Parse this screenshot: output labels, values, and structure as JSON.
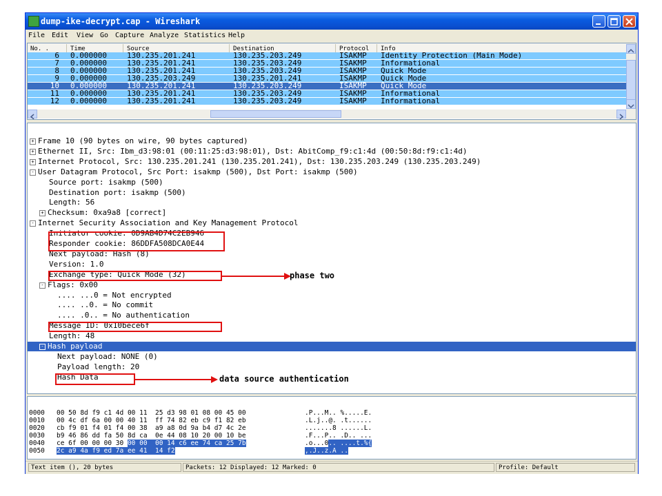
{
  "window": {
    "title": "dump-ike-decrypt.cap - Wireshark",
    "colors": {
      "titlebar": "#0a5ce0",
      "row_bg": "#7ecaff",
      "selection": "#3163c4",
      "highlight": "#e01010"
    }
  },
  "menu": [
    "File",
    "Edit",
    "View",
    "Go",
    "Capture",
    "Analyze",
    "Statistics",
    "Help"
  ],
  "packet_list": {
    "columns": [
      "No. .",
      "Time",
      "Source",
      "Destination",
      "Protocol",
      "Info"
    ],
    "rows": [
      {
        "no": "6",
        "time": "0.000000",
        "src": "130.235.201.241",
        "dst": "130.235.203.249",
        "proto": "ISAKMP",
        "info": "Identity Protection (Main Mode)"
      },
      {
        "no": "7",
        "time": "0.000000",
        "src": "130.235.201.241",
        "dst": "130.235.203.249",
        "proto": "ISAKMP",
        "info": "Informational"
      },
      {
        "no": "8",
        "time": "0.000000",
        "src": "130.235.201.241",
        "dst": "130.235.203.249",
        "proto": "ISAKMP",
        "info": "Quick Mode"
      },
      {
        "no": "9",
        "time": "0.000000",
        "src": "130.235.203.249",
        "dst": "130.235.201.241",
        "proto": "ISAKMP",
        "info": "Quick Mode"
      },
      {
        "no": "10",
        "time": "0.000000",
        "src": "130.235.201.241",
        "dst": "130.235.203.249",
        "proto": "ISAKMP",
        "info": "Quick Mode"
      },
      {
        "no": "11",
        "time": "0.000000",
        "src": "130.235.201.241",
        "dst": "130.235.203.249",
        "proto": "ISAKMP",
        "info": "Informational"
      },
      {
        "no": "12",
        "time": "0.000000",
        "src": "130.235.201.241",
        "dst": "130.235.203.249",
        "proto": "ISAKMP",
        "info": "Informational"
      }
    ],
    "selected_no": "10"
  },
  "detail_tree": [
    {
      "text": "Frame 10 (90 bytes on wire, 90 bytes captured)",
      "level": 0,
      "toggle": "+"
    },
    {
      "text": "Ethernet II, Src: Ibm_d3:98:01 (00:11:25:d3:98:01), Dst: AbitComp_f9:c1:4d (00:50:8d:f9:c1:4d)",
      "level": 0,
      "toggle": "+"
    },
    {
      "text": "Internet Protocol, Src: 130.235.201.241 (130.235.201.241), Dst: 130.235.203.249 (130.235.203.249)",
      "level": 0,
      "toggle": "+"
    },
    {
      "text": "User Datagram Protocol, Src Port: isakmp (500), Dst Port: isakmp (500)",
      "level": 0,
      "toggle": "-"
    },
    {
      "text": "Source port: isakmp (500)",
      "level": 1,
      "toggle": ""
    },
    {
      "text": "Destination port: isakmp (500)",
      "level": 1,
      "toggle": ""
    },
    {
      "text": "Length: 56",
      "level": 1,
      "toggle": ""
    },
    {
      "text": "Checksum: 0xa9a8 [correct]",
      "level": 1,
      "toggle": "+"
    },
    {
      "text": "Internet Security Association and Key Management Protocol",
      "level": 0,
      "toggle": "-"
    },
    {
      "text": "Initiator cookie: 0D9AB4D74C2EB946",
      "level": 1,
      "toggle": ""
    },
    {
      "text": "Responder cookie: 86DDFA508DCA0E44",
      "level": 1,
      "toggle": ""
    },
    {
      "text": "Next payload: Hash (8)",
      "level": 1,
      "toggle": ""
    },
    {
      "text": "Version: 1.0",
      "level": 1,
      "toggle": ""
    },
    {
      "text": "Exchange type: Quick Mode (32)",
      "level": 1,
      "toggle": ""
    },
    {
      "text": "Flags: 0x00",
      "level": 1,
      "toggle": "-"
    },
    {
      "text": ".... ...0 = Not encrypted",
      "level": 2,
      "toggle": ""
    },
    {
      "text": ".... ..0. = No commit",
      "level": 2,
      "toggle": ""
    },
    {
      "text": ".... .0.. = No authentication",
      "level": 2,
      "toggle": ""
    },
    {
      "text": "Message ID: 0x10bece6f",
      "level": 1,
      "toggle": ""
    },
    {
      "text": "Length: 48",
      "level": 1,
      "toggle": ""
    },
    {
      "text": "Hash payload",
      "level": 1,
      "toggle": "-",
      "selected": true
    },
    {
      "text": "Next payload: NONE (0)",
      "level": 2,
      "toggle": ""
    },
    {
      "text": "Payload length: 20",
      "level": 2,
      "toggle": ""
    },
    {
      "text": "Hash Data",
      "level": 2,
      "toggle": ""
    }
  ],
  "annotations": {
    "phase_two": "phase two",
    "data_source_auth": "data source authentication"
  },
  "hex_dump": [
    {
      "offset": "0000",
      "bytes": "00 50 8d f9 c1 4d 00 11  25 d3 98 01 08 00 45 00",
      "ascii": ".P...M.. %.....E."
    },
    {
      "offset": "0010",
      "bytes": "00 4c df 6a 00 00 40 11  ff 74 82 eb c9 f1 82 eb",
      "ascii": ".L.j..@. .t......"
    },
    {
      "offset": "0020",
      "bytes": "cb f9 01 f4 01 f4 00 38  a9 a8 0d 9a b4 d7 4c 2e",
      "ascii": ".......8 ......L."
    },
    {
      "offset": "0030",
      "bytes": "b9 46 86 dd fa 50 8d ca  0e 44 08 10 20 00 10 be",
      "ascii": ".F...P.. .D.. ..."
    },
    {
      "offset": "0040",
      "bytes_pre": "ce 6f 00 00 00 30 ",
      "bytes_sel": "00 00  00 14 c6 ee 74 ca 25 7b",
      "ascii_pre": ".o...0",
      "ascii_sel": ".. ....t.%{"
    },
    {
      "offset": "0050",
      "bytes_sel": "2c a9 4a f9 ed 7a ee 41  14 f2",
      "ascii_sel": ",.J..z.A .."
    }
  ],
  "status": {
    "left": "Text item (), 20 bytes",
    "middle": "Packets: 12 Displayed: 12 Marked: 0",
    "right": "Profile: Default"
  }
}
